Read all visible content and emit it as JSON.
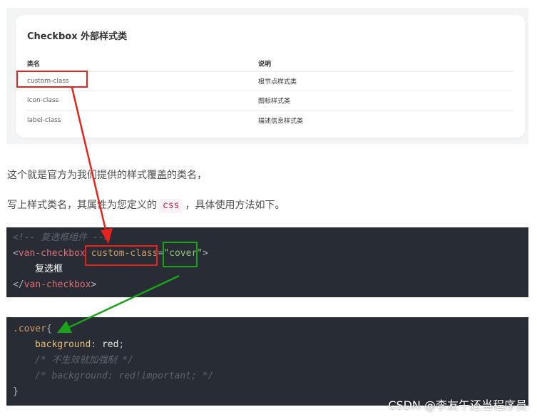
{
  "doc_panel": {
    "title": "Checkbox 外部样式类",
    "headers": [
      "类名",
      "说明"
    ],
    "rows": [
      [
        "custom-class",
        "根节点样式类"
      ],
      [
        "icon-class",
        "图标样式类"
      ],
      [
        "label-class",
        "描述信息样式类"
      ]
    ]
  },
  "article": {
    "paragraph1": "这个就是官方为我们提供的样式覆盖的类名，",
    "paragraph2_before": "写上样式类名，其属性为您定义的",
    "paragraph2_code": "css",
    "paragraph2_after": "，具体使用方法如下。"
  },
  "code_block_1": {
    "comment": "<!-- 复选框组件 -->",
    "open_bracket": "<",
    "tag": "van-checkbox",
    "attr": "custom-class",
    "equals": "=",
    "quote_open": "\"",
    "attr_value": "cover",
    "quote_close": "\"",
    "close_bracket": ">",
    "content": "复选框",
    "close_tag_open": "</",
    "close_tag_name": "van-checkbox",
    "close_tag_end": ">"
  },
  "code_block_2": {
    "selector": ".cover",
    "brace_open": "{",
    "prop": "background",
    "colon": ": ",
    "value": "red",
    "semicolon": ";",
    "comment1": "/* 不生效就加强制 */",
    "comment2": "/* background: red!important; */",
    "brace_close": "}"
  },
  "watermark": "CSDN @李友午还当程序员",
  "annotation_colors": {
    "red": "#e8231c",
    "green": "#1aa31a"
  }
}
